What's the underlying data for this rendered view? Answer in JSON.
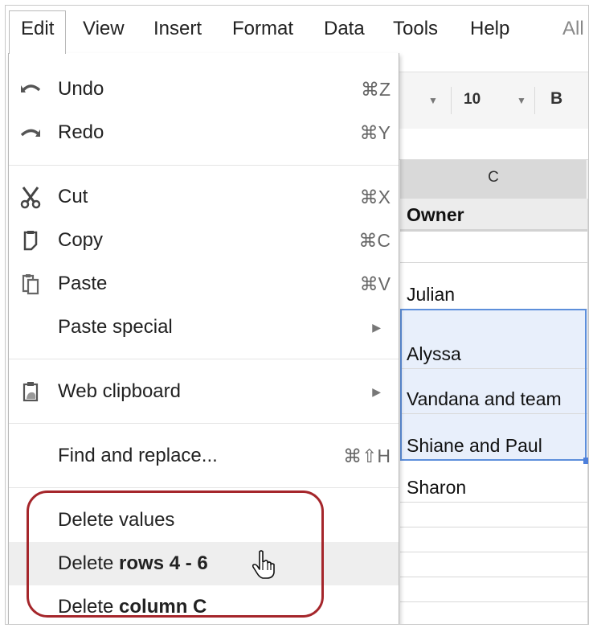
{
  "menubar": {
    "items": [
      "Edit",
      "View",
      "Insert",
      "Format",
      "Data",
      "Tools",
      "Help",
      "All"
    ]
  },
  "toolbar": {
    "font_size": "10",
    "bold_label": "B"
  },
  "sheet": {
    "column_header": "C",
    "cells": [
      "Owner",
      "",
      "Julian",
      "Alyssa",
      "Vandana and team",
      "Shiane and Paul",
      "Sharon",
      "",
      "",
      "",
      ""
    ]
  },
  "edit_menu": {
    "undo": {
      "label": "Undo",
      "shortcut": "⌘Z",
      "icon": "undo-icon"
    },
    "redo": {
      "label": "Redo",
      "shortcut": "⌘Y",
      "icon": "redo-icon"
    },
    "cut": {
      "label": "Cut",
      "shortcut": "⌘X",
      "icon": "scissors-icon"
    },
    "copy": {
      "label": "Copy",
      "shortcut": "⌘C",
      "icon": "copy-icon"
    },
    "paste": {
      "label": "Paste",
      "shortcut": "⌘V",
      "icon": "paste-icon"
    },
    "paste_special": {
      "label": "Paste special"
    },
    "web_clipboard": {
      "label": "Web clipboard",
      "icon": "clipboard-icon"
    },
    "find_replace": {
      "label": "Find and replace...",
      "shortcut": "⌘⇧H"
    },
    "delete_values": {
      "label": "Delete values"
    },
    "delete_rows": {
      "prefix": "Delete ",
      "bold": "rows 4 - 6"
    },
    "delete_column": {
      "prefix": "Delete ",
      "bold": "column C"
    }
  },
  "colors": {
    "callout": "#a5262b",
    "selection": "#5d8fdb",
    "selection_fill": "#e8effb",
    "highlight": "#eeeeee"
  }
}
